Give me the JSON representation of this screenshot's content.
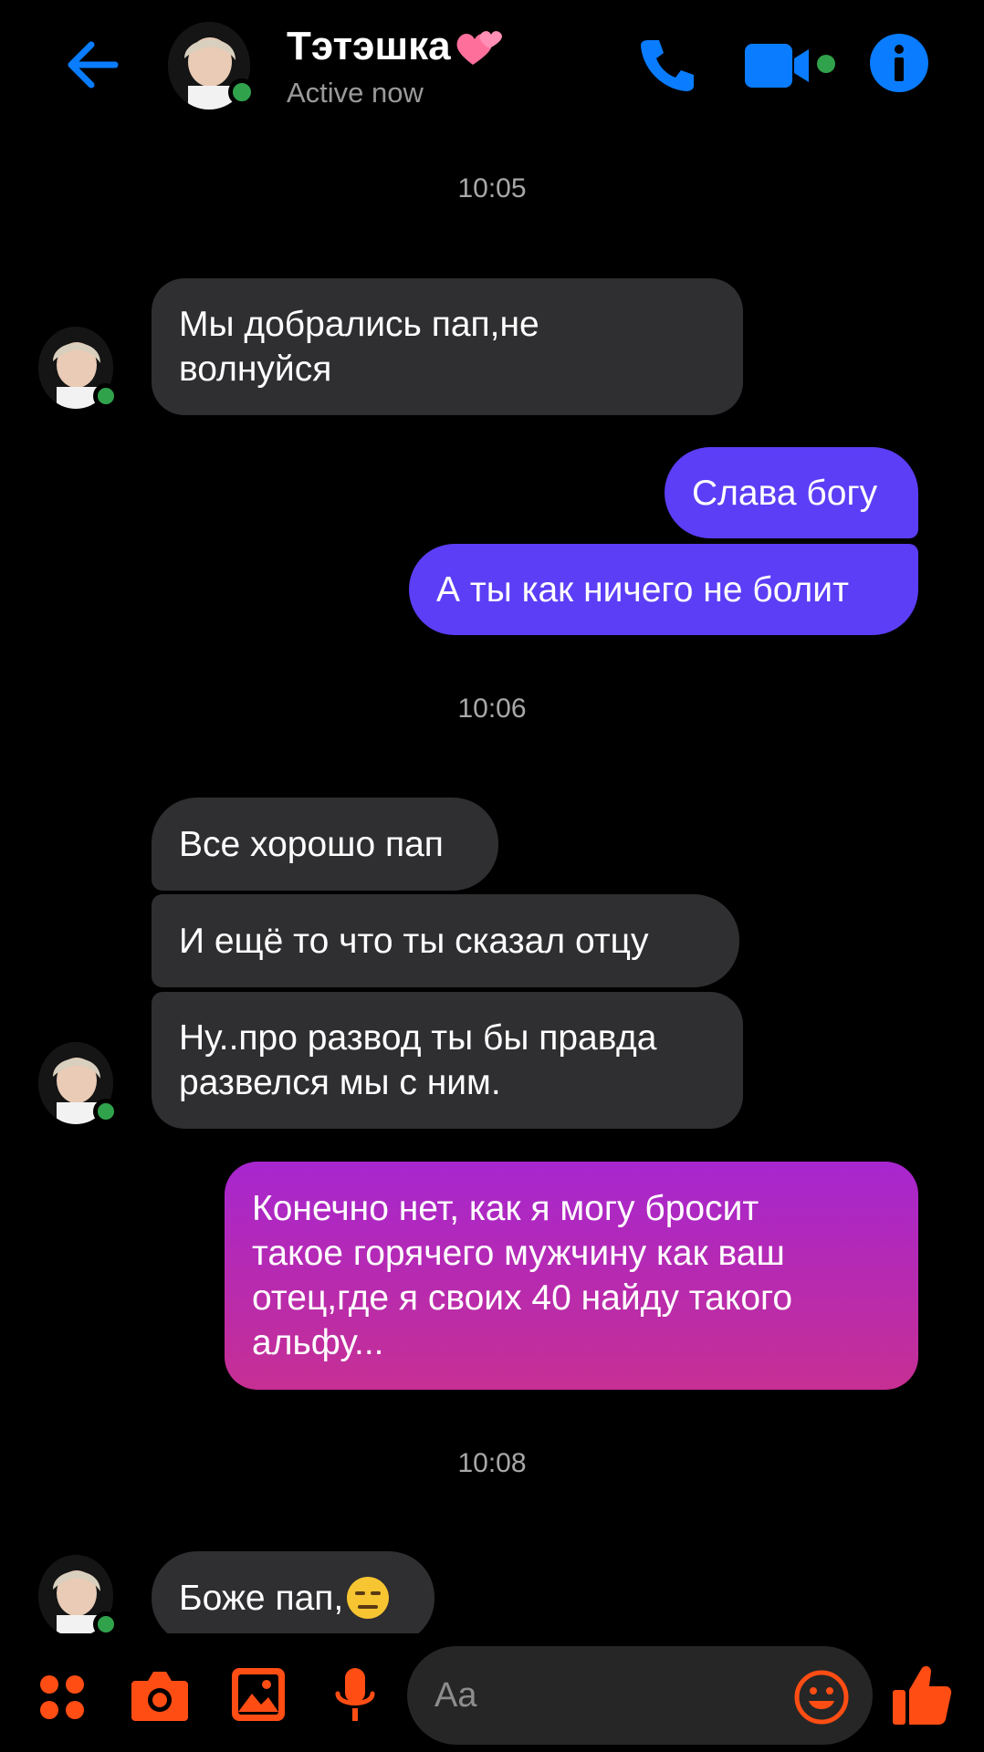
{
  "header": {
    "contact_name": "Тэтэшка",
    "status": "Active now"
  },
  "messages": {
    "t1": "10:05",
    "m1_line1": "Мы добрались пап,не",
    "m1_line2": "волнуйся",
    "m2": "Слава богу",
    "m3": "А ты как ничего не болит",
    "t2": "10:06",
    "m4": "Все хорошо пап",
    "m5": "И ещё то что ты сказал отцу",
    "m6_line1": "Ну..про развод ты бы правда",
    "m6_line2": "развелся мы с ним.",
    "m7_line1": "Конечно нет, как я могу бросит",
    "m7_line2": "такое горячего мужчину как ваш",
    "m7_line3": "отец,где я своих 40 найду такого",
    "m7_line4": "альфу...",
    "t3": "10:08",
    "m8": "Боже пап,"
  },
  "composer": {
    "placeholder": "Aa"
  },
  "colors": {
    "accent_blue": "#0a7cff",
    "outgoing_blue": "#5b3ef6",
    "outgoing_gradient_top": "#a726cf",
    "outgoing_gradient_bottom": "#c62f93",
    "incoming": "#2f2e30",
    "composer_accent": "#ff4d14",
    "presence": "#31a24c"
  },
  "icons": [
    "back-arrow-icon",
    "phone-icon",
    "video-camera-icon",
    "info-icon",
    "apps-icon",
    "camera-icon",
    "gallery-icon",
    "microphone-icon",
    "emoji-icon",
    "thumbs-up-icon"
  ]
}
